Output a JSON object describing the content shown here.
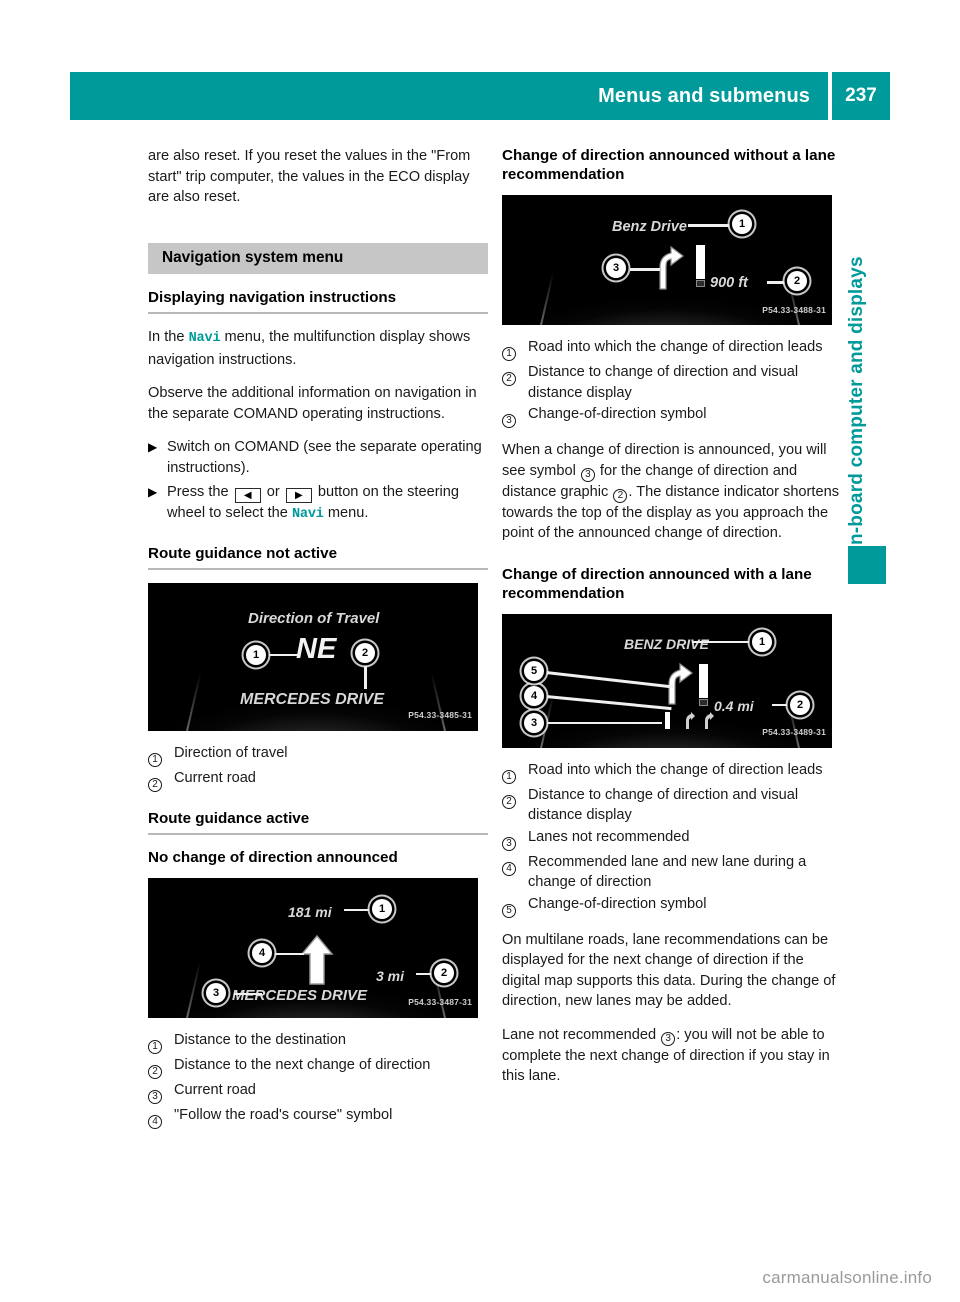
{
  "header": {
    "title": "Menus and submenus",
    "page_number": "237",
    "accent_color": "#009a9a"
  },
  "side_tab": {
    "label": "On-board computer and displays",
    "color": "#009a9a"
  },
  "watermark": "carmanualsonline.info",
  "left_column": {
    "intro_paragraph": "are also reset. If you reset the values in the \"From start\" trip computer, the values in the ECO display are also reset.",
    "section_bar": "Navigation system menu",
    "subheading_1": "Displaying navigation instructions",
    "para_1_pre": "In the ",
    "para_1_code": "Navi",
    "para_1_post": " menu, the multifunction display shows navigation instructions.",
    "para_2": "Observe the additional information on navigation in the separate COMAND operating instructions.",
    "step_1": "Switch on COMAND (see the separate operating instructions).",
    "step_2_pre": "Press the ",
    "step_2_key_left": "◀",
    "step_2_mid": " or ",
    "step_2_key_right": "▶",
    "step_2_post": " button on the steering wheel to select the ",
    "step_2_code": "Navi",
    "step_2_end": " menu.",
    "subheading_2": "Route guidance not active",
    "image_1": {
      "title": "Direction of Travel",
      "heading_value": "NE",
      "road_name": "MERCEDES DRIVE",
      "code": "P54.33-3485-31",
      "markers": [
        "1",
        "2"
      ]
    },
    "callouts_1": [
      {
        "num": "1",
        "text": "Direction of travel"
      },
      {
        "num": "2",
        "text": "Current road"
      }
    ],
    "subheading_3": "Route guidance active",
    "subheading_4": "No change of direction announced",
    "image_2": {
      "distance_destination": "181 mi",
      "distance_next": "3 mi",
      "road_name": "MERCEDES DRIVE",
      "code": "P54.33-3487-31",
      "markers": [
        "1",
        "2",
        "3",
        "4"
      ]
    },
    "callouts_2": [
      {
        "num": "1",
        "text": "Distance to the destination"
      },
      {
        "num": "2",
        "text": "Distance to the next change of direction"
      },
      {
        "num": "3",
        "text": "Current road"
      },
      {
        "num": "4",
        "text": "\"Follow the road's course\" symbol"
      }
    ]
  },
  "right_column": {
    "subheading_1": "Change of direction announced without a lane recommendation",
    "image_3": {
      "road_name": "Benz Drive",
      "distance": "900 ft",
      "code": "P54.33-3488-31",
      "markers": [
        "1",
        "2",
        "3"
      ]
    },
    "callouts_3": [
      {
        "num": "1",
        "text": "Road into which the change of direction leads"
      },
      {
        "num": "2",
        "text": "Distance to change of direction and visual distance display"
      },
      {
        "num": "3",
        "text": "Change-of-direction symbol"
      }
    ],
    "para_1_a": "When a change of direction is announced, you will see symbol ",
    "para_1_ref1": "3",
    "para_1_b": " for the change of direction and distance graphic ",
    "para_1_ref2": "2",
    "para_1_c": ". The distance indicator shortens towards the top of the display as you approach the point of the announced change of direction.",
    "subheading_2": "Change of direction announced with a lane recommendation",
    "image_4": {
      "road_name": "BENZ DRIVE",
      "distance": "0.4 mi",
      "code": "P54.33-3489-31",
      "markers": [
        "1",
        "2",
        "3",
        "4",
        "5"
      ]
    },
    "callouts_4": [
      {
        "num": "1",
        "text": "Road into which the change of direction leads"
      },
      {
        "num": "2",
        "text": "Distance to change of direction and visual distance display"
      },
      {
        "num": "3",
        "text": "Lanes not recommended"
      },
      {
        "num": "4",
        "text": "Recommended lane and new lane during a change of direction"
      },
      {
        "num": "5",
        "text": "Change-of-direction symbol"
      }
    ],
    "para_2": "On multilane roads, lane recommendations can be displayed for the next change of direction if the digital map supports this data. During the change of direction, new lanes may be added.",
    "para_3_a": "Lane not recommended ",
    "para_3_ref": "3",
    "para_3_b": ": you will not be able to complete the next change of direction if you stay in this lane."
  }
}
